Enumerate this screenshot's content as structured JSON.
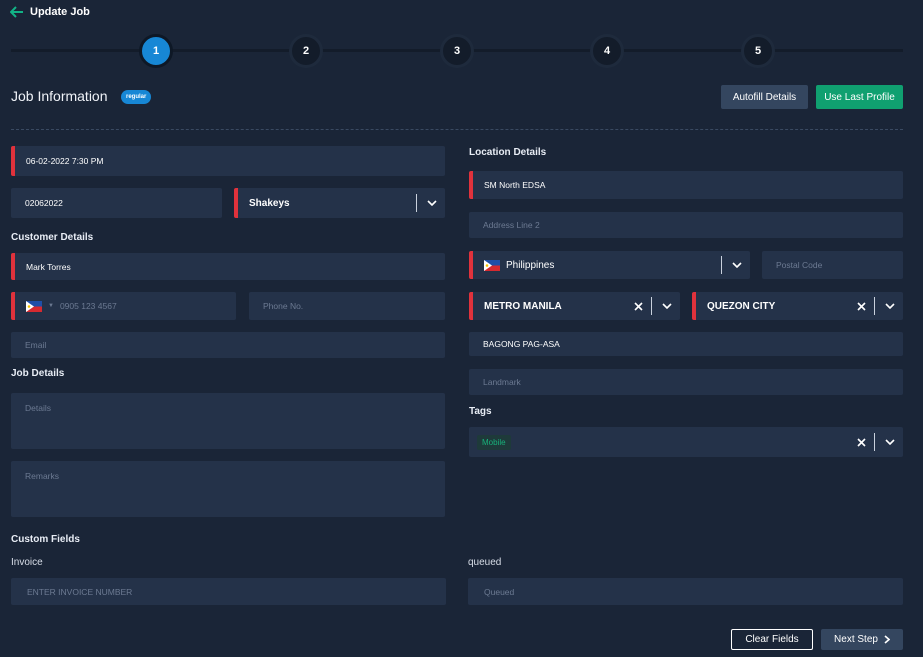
{
  "header": {
    "title": "Update Job"
  },
  "stepper": {
    "steps": [
      "1",
      "2",
      "3",
      "4",
      "5"
    ],
    "active": 1
  },
  "section": {
    "title": "Job Information",
    "badge": "regular"
  },
  "buttons": {
    "autofill": "Autofill Details",
    "use_last": "Use Last Profile",
    "clear": "Clear Fields",
    "next": "Next Step"
  },
  "left": {
    "datetime": "06-02-2022 7:30 PM",
    "job_no": "02062022",
    "store": "Shakeys",
    "customer_title": "Customer Details",
    "customer_name": "Mark Torres",
    "mobile_placeholder": "0905 123 4567",
    "phone_placeholder": "Phone No.",
    "email_placeholder": "Email",
    "job_details_title": "Job Details",
    "details_placeholder": "Details",
    "remarks_placeholder": "Remarks"
  },
  "right": {
    "location_title": "Location Details",
    "address1": "SM North EDSA",
    "address2_placeholder": "Address Line 2",
    "country": "Philippines",
    "postal_placeholder": "Postal Code",
    "region": "METRO MANILA",
    "city": "QUEZON CITY",
    "barangay": "BAGONG PAG-ASA",
    "landmark_placeholder": "Landmark",
    "tags_title": "Tags",
    "tag": "Mobile"
  },
  "custom": {
    "title": "Custom Fields",
    "invoice_label": "Invoice",
    "invoice_placeholder": "ENTER INVOICE NUMBER",
    "queued_label": "queued",
    "queued_placeholder": "Queued"
  },
  "colors": {
    "accent_green": "#10a070",
    "required_red": "#e0323c",
    "active_step": "#1787d5"
  }
}
